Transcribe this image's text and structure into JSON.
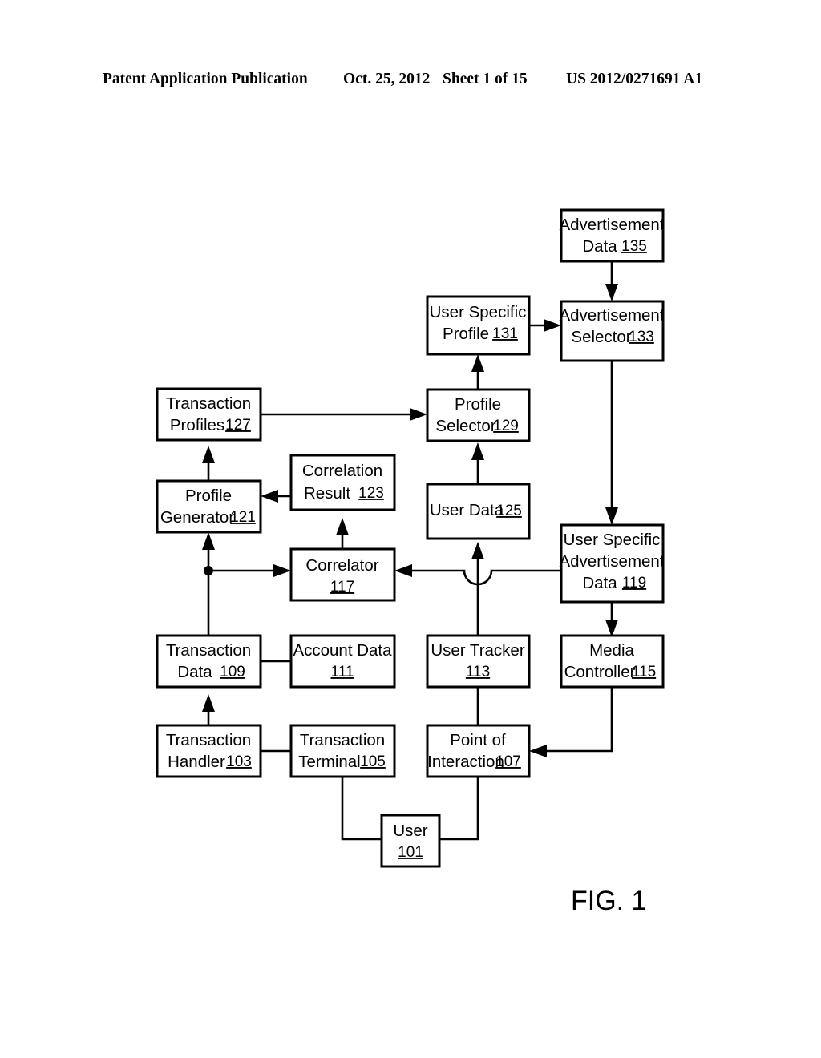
{
  "header": {
    "title": "Patent Application Publication",
    "date": "Oct. 25, 2012",
    "sheet": "Sheet 1 of 15",
    "publication_number": "US 2012/0271691 A1"
  },
  "figure": {
    "caption": "FIG. 1",
    "nodes": [
      {
        "id": "n135",
        "line1": "Advertisement",
        "line2": "Data",
        "ref": "135"
      },
      {
        "id": "n133",
        "line1": "Advertisement",
        "line2": "Selector",
        "ref": "133"
      },
      {
        "id": "n131",
        "line1": "User Specific",
        "line2": "Profile",
        "ref": "131"
      },
      {
        "id": "n129",
        "line1": "Profile",
        "line2": "Selector",
        "ref": "129"
      },
      {
        "id": "n127",
        "line1": "Transaction",
        "line2": "Profiles",
        "ref": "127"
      },
      {
        "id": "n123",
        "line1": "Correlation",
        "line2": "Result",
        "ref": "123"
      },
      {
        "id": "n125",
        "line1": "User Data",
        "line2": "",
        "ref": "125"
      },
      {
        "id": "n121",
        "line1": "Profile",
        "line2": "Generator",
        "ref": "121"
      },
      {
        "id": "n117",
        "line1": "Correlator",
        "line2": "",
        "ref": "117"
      },
      {
        "id": "n119",
        "line1": "User Specific",
        "line2": "Advertisement",
        "line3": "Data",
        "ref": "119"
      },
      {
        "id": "n109",
        "line1": "Transaction",
        "line2": "Data",
        "ref": "109"
      },
      {
        "id": "n111",
        "line1": "Account Data",
        "line2": "",
        "ref": "111"
      },
      {
        "id": "n113",
        "line1": "User Tracker",
        "line2": "",
        "ref": "113"
      },
      {
        "id": "n115",
        "line1": "Media",
        "line2": "Controller",
        "ref": "115"
      },
      {
        "id": "n103",
        "line1": "Transaction",
        "line2": "Handler",
        "ref": "103"
      },
      {
        "id": "n105",
        "line1": "Transaction",
        "line2": "Terminal",
        "ref": "105"
      },
      {
        "id": "n107",
        "line1": "Point of",
        "line2": "Interaction",
        "ref": "107"
      },
      {
        "id": "n101",
        "line1": "User",
        "line2": "",
        "ref": "101"
      }
    ]
  },
  "colors": {
    "ink": "#000000",
    "paper": "#ffffff"
  }
}
